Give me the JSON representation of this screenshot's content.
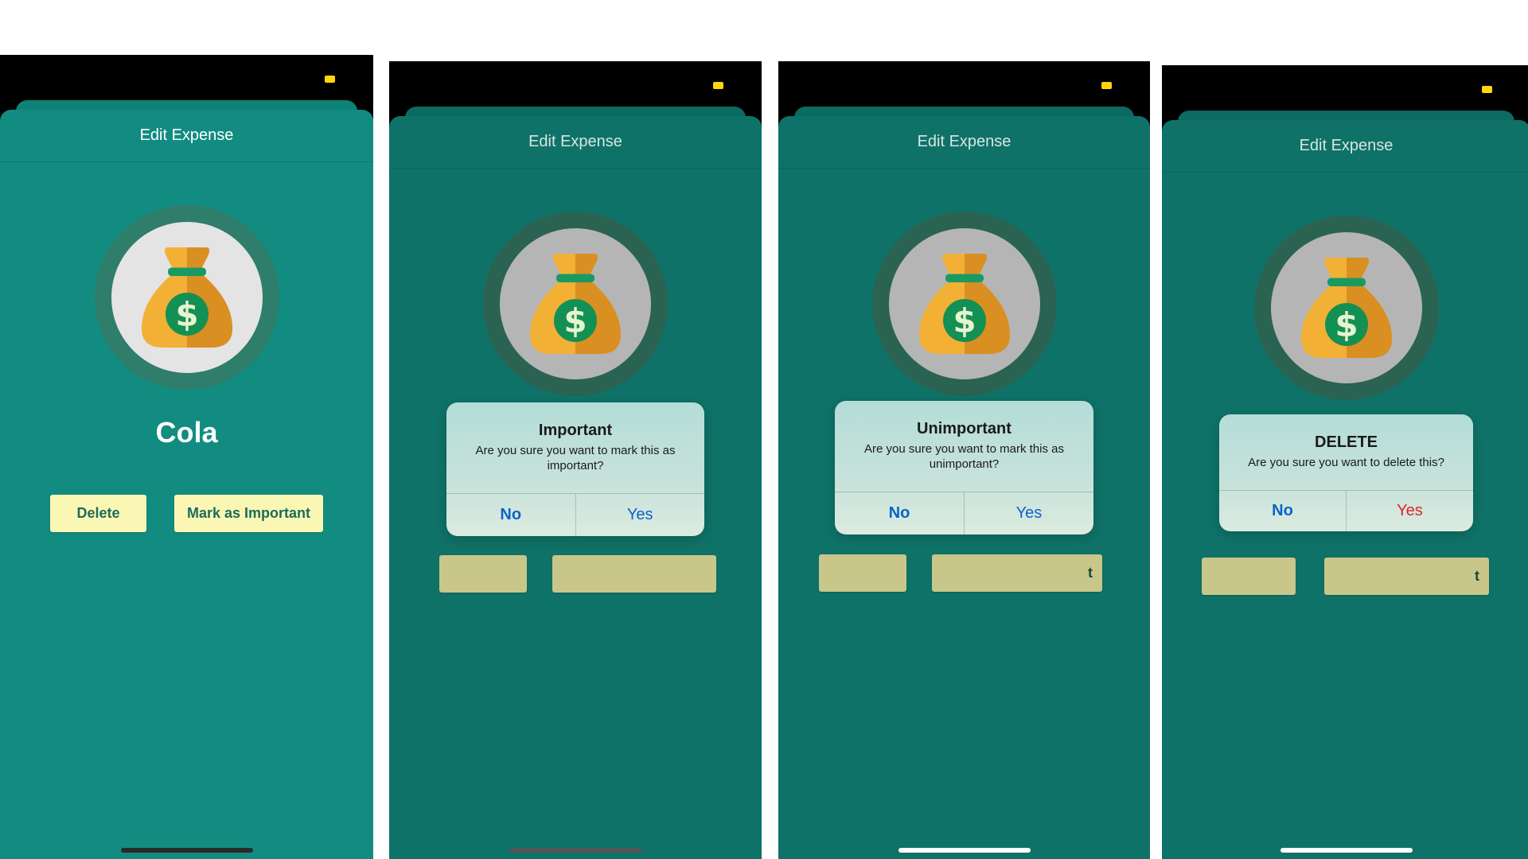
{
  "colors": {
    "card": "#128c80",
    "card_dimmed": "#0f7268",
    "button_bg": "#faf7b5",
    "button_text": "#1f6a5a",
    "alert_action": "#0a63c9",
    "destructive_action": "#e0262b",
    "status_indicator": "#ffd60a"
  },
  "screens": [
    {
      "nav_title": "Edit Expense",
      "avatar_icon": "money-bag-icon",
      "expense_name": "Cola",
      "delete_label": "Delete",
      "mark_label": "Mark as Important"
    },
    {
      "nav_title": "Edit Expense",
      "avatar_icon": "money-bag-icon",
      "alert": {
        "title": "Important",
        "message": "Are you sure you want to mark this as important?",
        "no_label": "No",
        "yes_label": "Yes"
      }
    },
    {
      "nav_title": "Edit Expense",
      "avatar_icon": "money-bag-icon",
      "mark_partial": "t",
      "alert": {
        "title": "Unimportant",
        "message": "Are you sure you want to mark this as unimportant?",
        "no_label": "No",
        "yes_label": "Yes"
      }
    },
    {
      "nav_title": "Edit Expense",
      "avatar_icon": "money-bag-icon",
      "mark_partial": "t",
      "alert": {
        "title": "DELETE",
        "message": "Are you sure you want to delete this?",
        "no_label": "No",
        "yes_label": "Yes"
      }
    }
  ]
}
